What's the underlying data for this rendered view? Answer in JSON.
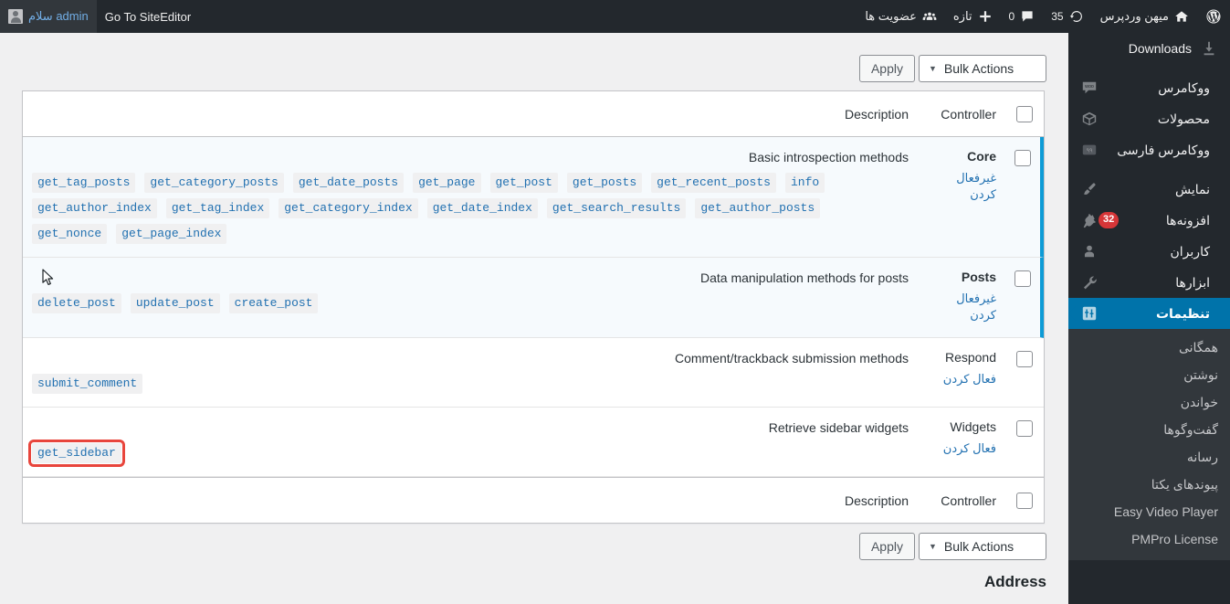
{
  "adminbar": {
    "left_items": [
      {
        "name": "avatar",
        "icon": "avatar-icon",
        "label": "سلام admin"
      },
      {
        "name": "site-editor",
        "icon": "",
        "label": "Go To SiteEditor"
      }
    ],
    "right_items": [
      {
        "name": "wordpress-logo",
        "icon": "wordpress-icon",
        "label": ""
      },
      {
        "name": "site-name",
        "icon": "home-icon",
        "label": "میهن وردپرس"
      },
      {
        "name": "updates",
        "icon": "updates-icon",
        "label": "35"
      },
      {
        "name": "comments",
        "icon": "comment-icon",
        "label": "0"
      },
      {
        "name": "new-content",
        "icon": "plus-icon",
        "label": "تازه"
      },
      {
        "name": "memberships",
        "icon": "users-icon",
        "label": "عضویت ها"
      }
    ]
  },
  "sidebar": {
    "items": [
      {
        "name": "downloads",
        "icon": "download-icon",
        "label": "Downloads",
        "badge": "",
        "current": false,
        "ltr": true
      },
      {
        "name": "separator-1",
        "icon": "",
        "label": "",
        "separator": true
      },
      {
        "name": "woocommerce",
        "icon": "woo-icon",
        "label": "ووکامرس",
        "badge": "",
        "current": false
      },
      {
        "name": "products",
        "icon": "box-icon",
        "label": "محصولات",
        "badge": "",
        "current": false
      },
      {
        "name": "woocommerce-farsi",
        "icon": "persian-icon",
        "label": "ووکامرس فارسی",
        "badge": "",
        "current": false
      },
      {
        "name": "separator-2",
        "icon": "",
        "label": "",
        "separator": true
      },
      {
        "name": "appearance",
        "icon": "brush-icon",
        "label": "نمایش",
        "badge": "",
        "current": false
      },
      {
        "name": "plugins",
        "icon": "plug-icon",
        "label": "افزونه‌ها",
        "badge": "32",
        "current": false
      },
      {
        "name": "users",
        "icon": "user-icon",
        "label": "کاربران",
        "badge": "",
        "current": false
      },
      {
        "name": "tools",
        "icon": "wrench-icon",
        "label": "ابزارها",
        "badge": "",
        "current": false
      },
      {
        "name": "settings",
        "icon": "sliders-icon",
        "label": "تنظیمات",
        "badge": "",
        "current": true
      }
    ],
    "submenu": [
      {
        "name": "general",
        "label": "همگانی",
        "ltr": false
      },
      {
        "name": "writing",
        "label": "نوشتن",
        "ltr": false
      },
      {
        "name": "reading",
        "label": "خواندن",
        "ltr": false
      },
      {
        "name": "discussion",
        "label": "گفت‌وگوها",
        "ltr": false
      },
      {
        "name": "media",
        "label": "رسانه",
        "ltr": false
      },
      {
        "name": "permalinks",
        "label": "پیوندهای یکتا",
        "ltr": false
      },
      {
        "name": "easy-video-player",
        "label": "Easy Video Player",
        "ltr": true
      },
      {
        "name": "pmpro-license",
        "label": "PMPro License",
        "ltr": true
      }
    ]
  },
  "main": {
    "bulk_actions_label": "Bulk Actions",
    "apply_label": "Apply",
    "caret": "▼",
    "columns": {
      "controller": "Controller",
      "description": "Description"
    },
    "rows": [
      {
        "name": "Core",
        "active": true,
        "action_label": "غیرفعال کردن",
        "description": "Basic introspection methods",
        "methods": [
          "get_nonce",
          "get_page_index",
          "get_author_index",
          "get_tag_index",
          "get_category_index",
          "get_date_index",
          "get_search_results",
          "get_author_posts",
          "get_tag_posts",
          "get_category_posts",
          "get_date_posts",
          "get_page",
          "get_post",
          "get_posts",
          "get_recent_posts",
          "info"
        ],
        "highlight_method": ""
      },
      {
        "name": "Posts",
        "active": true,
        "action_label": "غیرفعال کردن",
        "description": "Data manipulation methods for posts",
        "methods": [
          "delete_post",
          "update_post",
          "create_post"
        ],
        "highlight_method": ""
      },
      {
        "name": "Respond",
        "active": false,
        "action_label": "فعال کردن",
        "description": "Comment/trackback submission methods",
        "methods": [
          "submit_comment"
        ],
        "highlight_method": ""
      },
      {
        "name": "Widgets",
        "active": false,
        "action_label": "فعال کردن",
        "description": "Retrieve sidebar widgets",
        "methods": [
          "get_sidebar"
        ],
        "highlight_method": "get_sidebar"
      }
    ],
    "section_title": "Address"
  },
  "colors": {
    "adminbar_bg": "#23282d",
    "sidebar_bg": "#23282d",
    "submenu_bg": "#32373c",
    "current_menu": "#0073aa",
    "link": "#2271b1",
    "badge": "#d63638",
    "row_active_accent": "#0d9bd6",
    "highlight_outline": "#e8453c",
    "page_bg": "#f0f0f1"
  }
}
